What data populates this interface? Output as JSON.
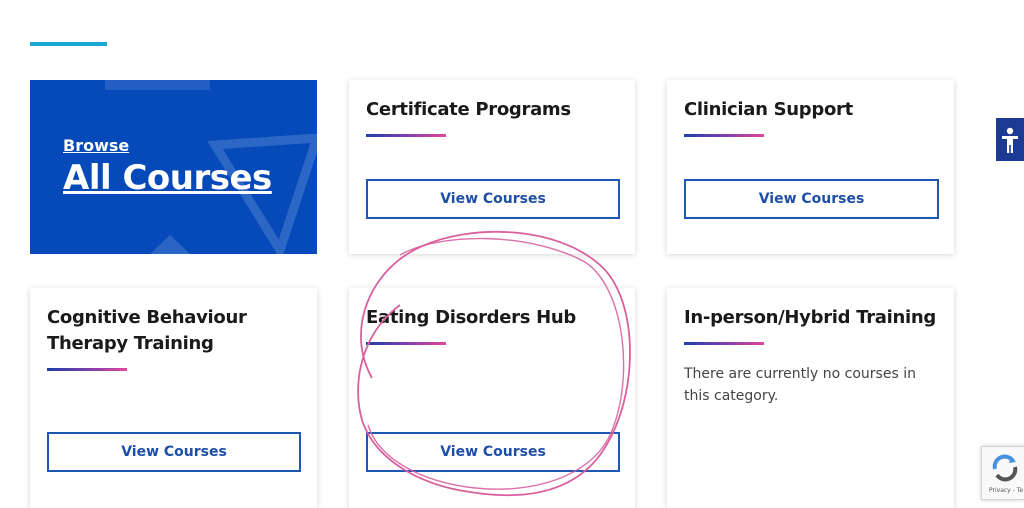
{
  "browse_card": {
    "small": "Browse",
    "big": "All Courses"
  },
  "cards": [
    {
      "title": "Certificate Programs",
      "button": "View Courses"
    },
    {
      "title": "Clinician Support",
      "button": "View Courses"
    },
    {
      "title": "Cognitive Behaviour Therapy Training",
      "button": "View Courses"
    },
    {
      "title": "Eating Disorders Hub",
      "button": "View Courses"
    },
    {
      "title": "In-person/Hybrid Training",
      "message": "There are currently no courses in this category."
    }
  ],
  "recaptcha": {
    "text": "Privacy - Te"
  },
  "colors": {
    "accent_line": "#1aa9d6",
    "browse_bg": "#064aba",
    "button_border": "#1d56b3",
    "annotation": "#d9609e"
  },
  "icons": [
    "accessibility-icon",
    "recaptcha-icon"
  ]
}
